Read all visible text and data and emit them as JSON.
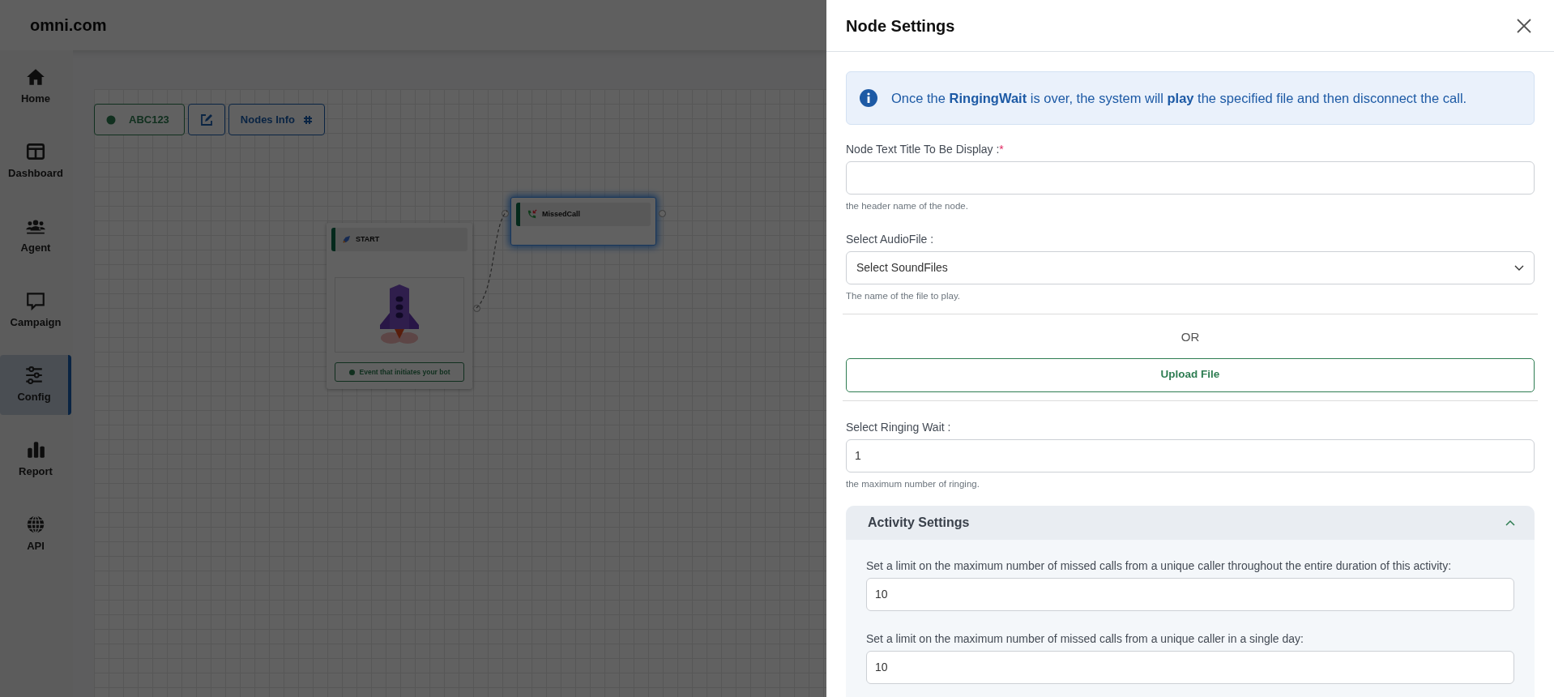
{
  "brand": "omni.com",
  "sidebar": {
    "items": [
      {
        "kind": "home",
        "label": "Home",
        "selected": false
      },
      {
        "kind": "dashboard",
        "label": "Dashboard",
        "selected": false
      },
      {
        "kind": "agent",
        "label": "Agent",
        "selected": false
      },
      {
        "kind": "campaign",
        "label": "Campaign",
        "selected": false
      },
      {
        "kind": "config",
        "label": "Config",
        "selected": true
      },
      {
        "kind": "report",
        "label": "Report",
        "selected": false
      },
      {
        "kind": "api",
        "label": "API",
        "selected": false
      }
    ]
  },
  "toolbar": {
    "flow_name": "ABC123",
    "nodes_info": "Nodes Info"
  },
  "canvas": {
    "nodes": [
      {
        "kind": "start",
        "title": "START",
        "event": "Event that initiates your bot",
        "selected": false
      },
      {
        "kind": "missed_call",
        "title": "MissedCall",
        "selected": true
      }
    ]
  },
  "panel": {
    "title": "Node Settings",
    "info": "Once the **RingingWait** is over, the system will **play** the specified file and then disconnect the call.",
    "title_field": {
      "label": "Node Text Title To Be Display :",
      "required_mark": "*",
      "help": "the header name of the node."
    },
    "audio_select": {
      "label": "Select AudioFile :",
      "value": "Select SoundFiles",
      "help": "The name of the file to play."
    },
    "or": "OR",
    "upload_button": "Upload File",
    "ringing_field": {
      "label": "Select Ringing Wait :",
      "value": "1",
      "help": "the maximum number of ringing."
    },
    "activity": {
      "title": "Activity Settings",
      "expanded": true,
      "fields": [
        {
          "label": "Set a limit on the maximum number of missed calls from a unique caller throughout the entire duration of this activity:",
          "value": "10"
        },
        {
          "label": "Set a limit on the maximum number of missed calls from a unique caller in a single day:",
          "value": "10"
        }
      ]
    }
  }
}
